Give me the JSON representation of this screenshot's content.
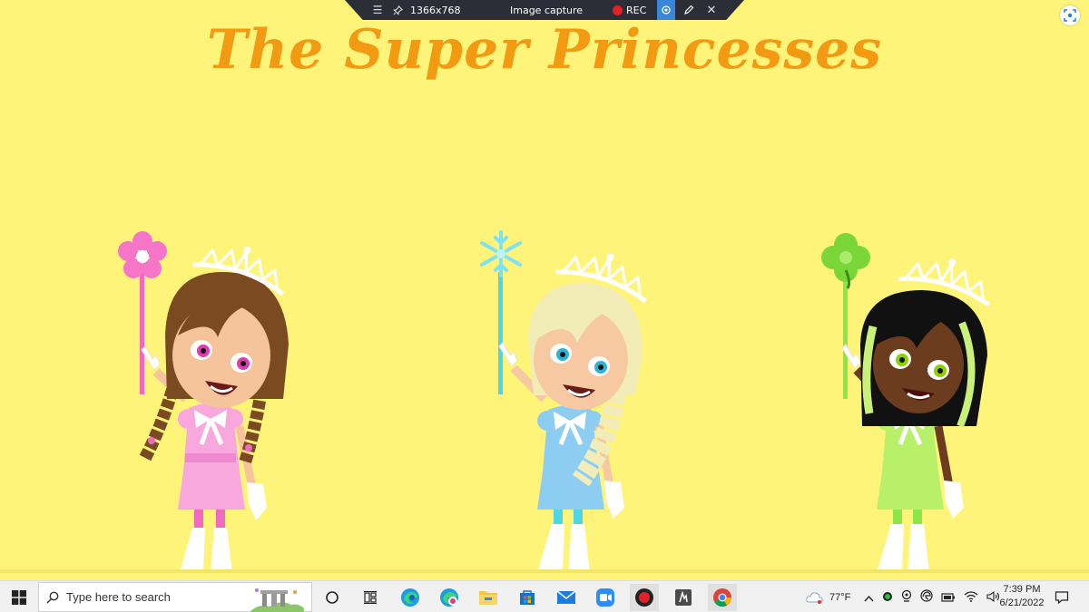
{
  "capture_toolbar": {
    "resolution": "1366x768",
    "mode": "Image capture",
    "rec_label": "REC"
  },
  "title": "The Super Princesses",
  "characters": [
    {
      "id": "pink",
      "hair": "#7A4A20",
      "dress": "#F9A8DE",
      "accent": "#F06BC0",
      "eyes": "#E23AB0",
      "skin": "#F6C49B",
      "wand": "flower"
    },
    {
      "id": "blue",
      "hair": "#F2EDB8",
      "dress": "#8ECDF2",
      "accent": "#4FD5E8",
      "eyes": "#28B5D8",
      "skin": "#F6C9A3",
      "wand": "snowflake"
    },
    {
      "id": "green",
      "hair": "#111111",
      "dress": "#B8F06A",
      "accent": "#8AE64A",
      "eyes": "#8ED000",
      "skin": "#6B3D1E",
      "wand": "clover"
    }
  ],
  "taskbar": {
    "search_placeholder": "Type here to search",
    "apps": [
      "task-view",
      "widgets",
      "edge",
      "edge-beta",
      "file-explorer",
      "microsoft-store",
      "mail",
      "zoom",
      "recorder",
      "studio",
      "chrome"
    ],
    "weather": "77°F",
    "time": "7:39 PM",
    "date": "6/21/2022"
  },
  "colors": {
    "background": "#FFF47A",
    "title": "#F29A12",
    "taskbar": "#F1F1F1"
  }
}
